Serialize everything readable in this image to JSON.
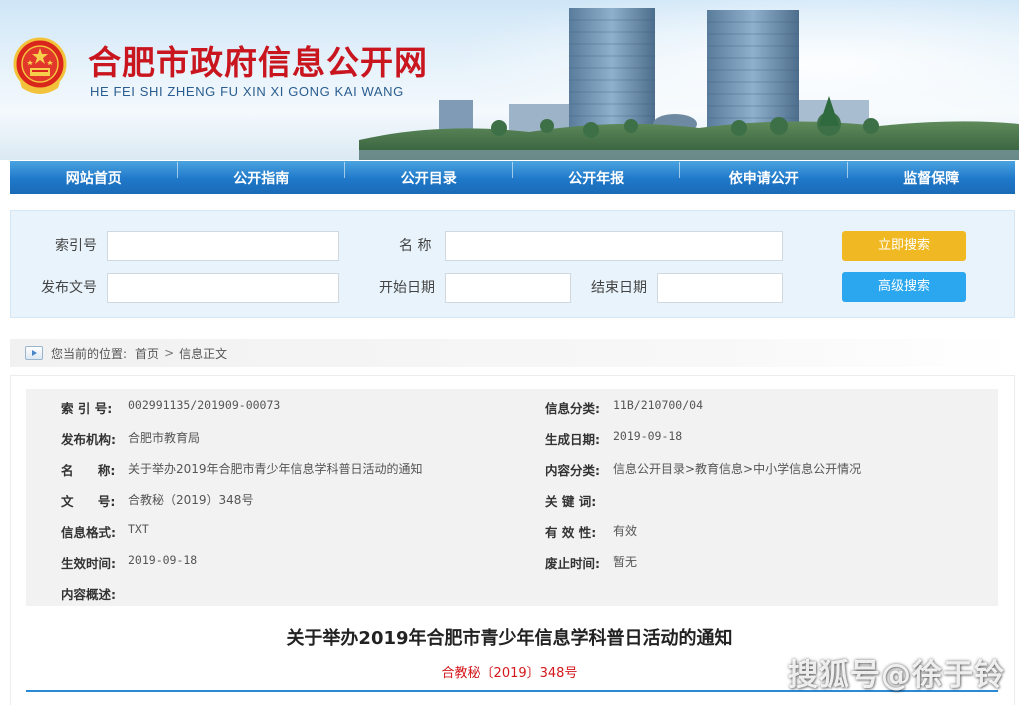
{
  "header": {
    "title": "合肥市政府信息公开网",
    "pinyin": "HE FEI SHI ZHENG FU XIN XI GONG KAI WANG"
  },
  "nav": {
    "items": [
      "网站首页",
      "公开指南",
      "公开目录",
      "公开年报",
      "依申请公开",
      "监督保障"
    ]
  },
  "search": {
    "labels": {
      "index_no": "索引号",
      "name": "名 称",
      "doc_no": "发布文号",
      "start_date": "开始日期",
      "end_date": "结束日期"
    },
    "search_button": "立即搜索",
    "advanced_button": "高级搜索"
  },
  "breadcrumb": {
    "prefix": "您当前的位置:",
    "home": "首页",
    "current": "信息正文"
  },
  "info": {
    "index_no_label": "索 引 号:",
    "index_no": "002991135/201909-00073",
    "category_label": "信息分类:",
    "category": "11B/210700/04",
    "publisher_label": "发布机构:",
    "publisher": "合肥市教育局",
    "created_label": "生成日期:",
    "created": "2019-09-18",
    "name_label": "名 称:",
    "name": "关于举办2019年合肥市青少年信息学科普日活动的通知",
    "content_class_label": "内容分类:",
    "content_class": "信息公开目录>教育信息>中小学信息公开情况",
    "doc_no_label": "文 号:",
    "doc_no": "合教秘（2019）348号",
    "keywords_label": "关 键 词:",
    "keywords": "",
    "format_label": "信息格式:",
    "format": "TXT",
    "validity_label": "有 效 性:",
    "validity": "有效",
    "effective_label": "生效时间:",
    "effective": "2019-09-18",
    "repeal_label": "废止时间:",
    "repeal": "暂无",
    "summary_label": "内容概述:",
    "summary": ""
  },
  "article": {
    "title": "关于举办2019年合肥市青少年信息学科普日活动的通知",
    "doc_no": "合教秘〔2019〕348号"
  },
  "watermark": "搜狐号@徐于铃",
  "colors": {
    "brand_red": "#c9151e",
    "nav_blue": "#1f78c9",
    "search_yellow": "#f0b923",
    "advanced_blue": "#2aa7ee",
    "docno_red": "#d4161b"
  }
}
